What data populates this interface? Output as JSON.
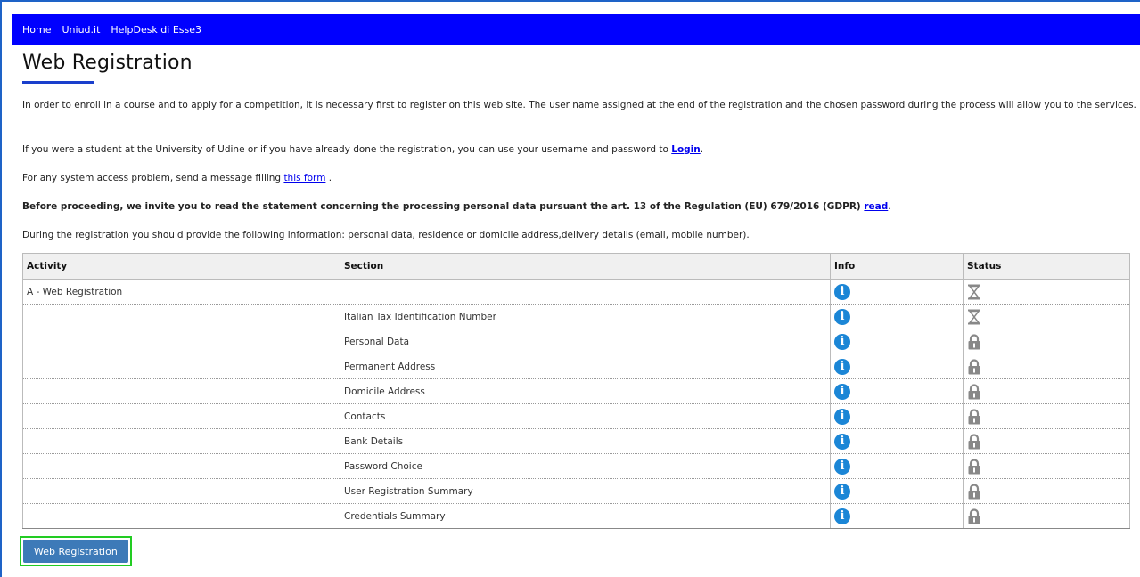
{
  "nav": {
    "items": [
      "Home",
      "Uniud.it",
      "HelpDesk di Esse3"
    ]
  },
  "page": {
    "title": "Web Registration",
    "intro": "In order to enroll in a course and to apply for a competition, it is necessary first to register on this web site. The user name assigned at the end of the registration and the chosen password during the process will allow you to the services.",
    "student_text": "If you were a student at the University of Udine or if you have already done the registration, you can use your username and password to ",
    "login_link": "Login",
    "access_text": "For any system access problem, send a message filling ",
    "form_link": "this form",
    "access_suffix": " .",
    "privacy_text": "Before proceeding, we invite you to read the statement concerning the processing personal data pursuant the art. 13 of the Regulation (EU) 679/2016 (GDPR) ",
    "privacy_link": "read",
    "info_text": "During the registration you should provide the following information: personal data, residence or domicile address,delivery details (email, mobile number)."
  },
  "table": {
    "headers": [
      "Activity",
      "Section",
      "Info",
      "Status"
    ],
    "rows": [
      {
        "activity": "A - Web Registration",
        "section": "",
        "status": "hourglass-icon"
      },
      {
        "activity": "",
        "section": "Italian Tax Identification Number",
        "status": "hourglass-icon"
      },
      {
        "activity": "",
        "section": "Personal Data",
        "status": "lock-icon"
      },
      {
        "activity": "",
        "section": "Permanent Address",
        "status": "lock-icon"
      },
      {
        "activity": "",
        "section": "Domicile Address",
        "status": "lock-icon"
      },
      {
        "activity": "",
        "section": "Contacts",
        "status": "lock-icon"
      },
      {
        "activity": "",
        "section": "Bank Details",
        "status": "lock-icon"
      },
      {
        "activity": "",
        "section": "Password Choice",
        "status": "lock-icon"
      },
      {
        "activity": "",
        "section": "User Registration Summary",
        "status": "lock-icon"
      },
      {
        "activity": "",
        "section": "Credentials Summary",
        "status": "lock-icon"
      }
    ],
    "info_icon_glyph": "i"
  },
  "button": {
    "label": "Web Registration"
  },
  "colors": {
    "nav_bg": "#0000ff",
    "button_bg": "#3d7ab8",
    "info_icon": "#1b86d6",
    "highlight": "#22cc22"
  }
}
